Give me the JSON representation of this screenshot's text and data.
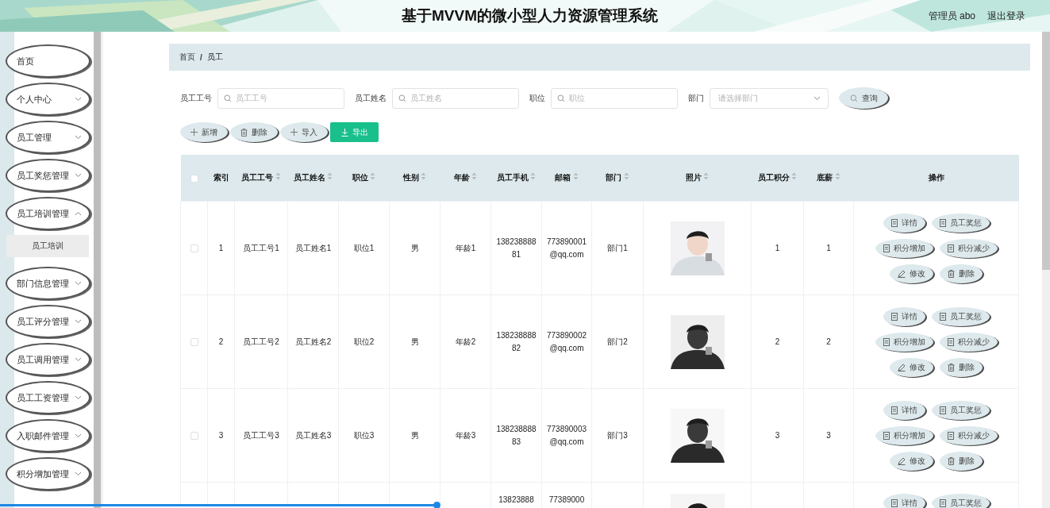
{
  "header": {
    "title": "基于MVVM的微小型人力资源管理系统",
    "user": "管理员 abo",
    "logout": "退出登录"
  },
  "sidebar": {
    "items": [
      {
        "label": "首页",
        "kind": "link"
      },
      {
        "label": "个人中心",
        "kind": "menu",
        "expanded": false
      },
      {
        "label": "员工管理",
        "kind": "menu",
        "expanded": false
      },
      {
        "label": "员工奖惩管理",
        "kind": "menu",
        "expanded": false
      },
      {
        "label": "员工培训管理",
        "kind": "menu",
        "expanded": true,
        "children": [
          {
            "label": "员工培训"
          }
        ]
      },
      {
        "label": "部门信息管理",
        "kind": "menu",
        "expanded": false
      },
      {
        "label": "员工评分管理",
        "kind": "menu",
        "expanded": false
      },
      {
        "label": "员工调用管理",
        "kind": "menu",
        "expanded": false
      },
      {
        "label": "员工工资管理",
        "kind": "menu",
        "expanded": false
      },
      {
        "label": "入职邮件管理",
        "kind": "menu",
        "expanded": false
      },
      {
        "label": "积分增加管理",
        "kind": "menu",
        "expanded": false
      }
    ]
  },
  "breadcrumb": {
    "items": [
      "首页",
      "员工"
    ],
    "separator": "/"
  },
  "search": {
    "fields": [
      {
        "label": "员工工号",
        "placeholder": "员工工号",
        "kind": "text"
      },
      {
        "label": "员工姓名",
        "placeholder": "员工姓名",
        "kind": "text"
      },
      {
        "label": "职位",
        "placeholder": "职位",
        "kind": "text"
      },
      {
        "label": "部门",
        "placeholder": "请选择部门",
        "kind": "select"
      }
    ],
    "button": "查询"
  },
  "toolbar": [
    {
      "label": "新增",
      "kind": "plus",
      "primary": false
    },
    {
      "label": "删除",
      "kind": "trash",
      "primary": false
    },
    {
      "label": "导入",
      "kind": "plus",
      "primary": false
    },
    {
      "label": "导出",
      "kind": "download",
      "primary": true
    }
  ],
  "table": {
    "select_all": {
      "checked": false
    },
    "columns": [
      {
        "label": "索引",
        "sortable": false
      },
      {
        "label": "员工工号",
        "sortable": true
      },
      {
        "label": "员工姓名",
        "sortable": true
      },
      {
        "label": "职位",
        "sortable": true
      },
      {
        "label": "性别",
        "sortable": true
      },
      {
        "label": "年龄",
        "sortable": true
      },
      {
        "label": "员工手机",
        "sortable": true
      },
      {
        "label": "邮箱",
        "sortable": true
      },
      {
        "label": "部门",
        "sortable": true
      },
      {
        "label": "照片",
        "sortable": true
      },
      {
        "label": "员工积分",
        "sortable": true
      },
      {
        "label": "底薪",
        "sortable": true
      },
      {
        "label": "操作",
        "sortable": false
      }
    ],
    "rows": [
      {
        "checked": false,
        "index": "1",
        "id": "员工工号1",
        "name": "员工姓名1",
        "position": "职位1",
        "gender": "男",
        "age": "年龄1",
        "phone": "13823888881",
        "email": "773890001@qq.com",
        "dept": "部门1",
        "points": "1",
        "salary": "1",
        "actions": [
          {
            "label": "详情",
            "kind": "doc"
          },
          {
            "label": "员工奖惩",
            "kind": "doc"
          },
          {
            "label": "积分增加",
            "kind": "doc"
          },
          {
            "label": "积分减少",
            "kind": "doc"
          },
          {
            "label": "修改",
            "kind": "edit"
          },
          {
            "label": "删除",
            "kind": "trash"
          }
        ]
      },
      {
        "checked": false,
        "index": "2",
        "id": "员工工号2",
        "name": "员工姓名2",
        "position": "职位2",
        "gender": "男",
        "age": "年龄2",
        "phone": "13823888882",
        "email": "773890002@qq.com",
        "dept": "部门2",
        "points": "2",
        "salary": "2",
        "actions": [
          {
            "label": "详情",
            "kind": "doc"
          },
          {
            "label": "员工奖惩",
            "kind": "doc"
          },
          {
            "label": "积分增加",
            "kind": "doc"
          },
          {
            "label": "积分减少",
            "kind": "doc"
          },
          {
            "label": "修改",
            "kind": "edit"
          },
          {
            "label": "删除",
            "kind": "trash"
          }
        ]
      },
      {
        "checked": false,
        "index": "3",
        "id": "员工工号3",
        "name": "员工姓名3",
        "position": "职位3",
        "gender": "男",
        "age": "年龄3",
        "phone": "13823888883",
        "email": "773890003@qq.com",
        "dept": "部门3",
        "points": "3",
        "salary": "3",
        "actions": [
          {
            "label": "详情",
            "kind": "doc"
          },
          {
            "label": "员工奖惩",
            "kind": "doc"
          },
          {
            "label": "积分增加",
            "kind": "doc"
          },
          {
            "label": "积分减少",
            "kind": "doc"
          },
          {
            "label": "修改",
            "kind": "edit"
          },
          {
            "label": "删除",
            "kind": "trash"
          }
        ]
      },
      {
        "phone": "13823888",
        "email": "77389000",
        "actions": [
          {
            "label": "详情",
            "kind": "doc"
          },
          {
            "label": "员工奖惩",
            "kind": "doc"
          }
        ]
      }
    ]
  }
}
